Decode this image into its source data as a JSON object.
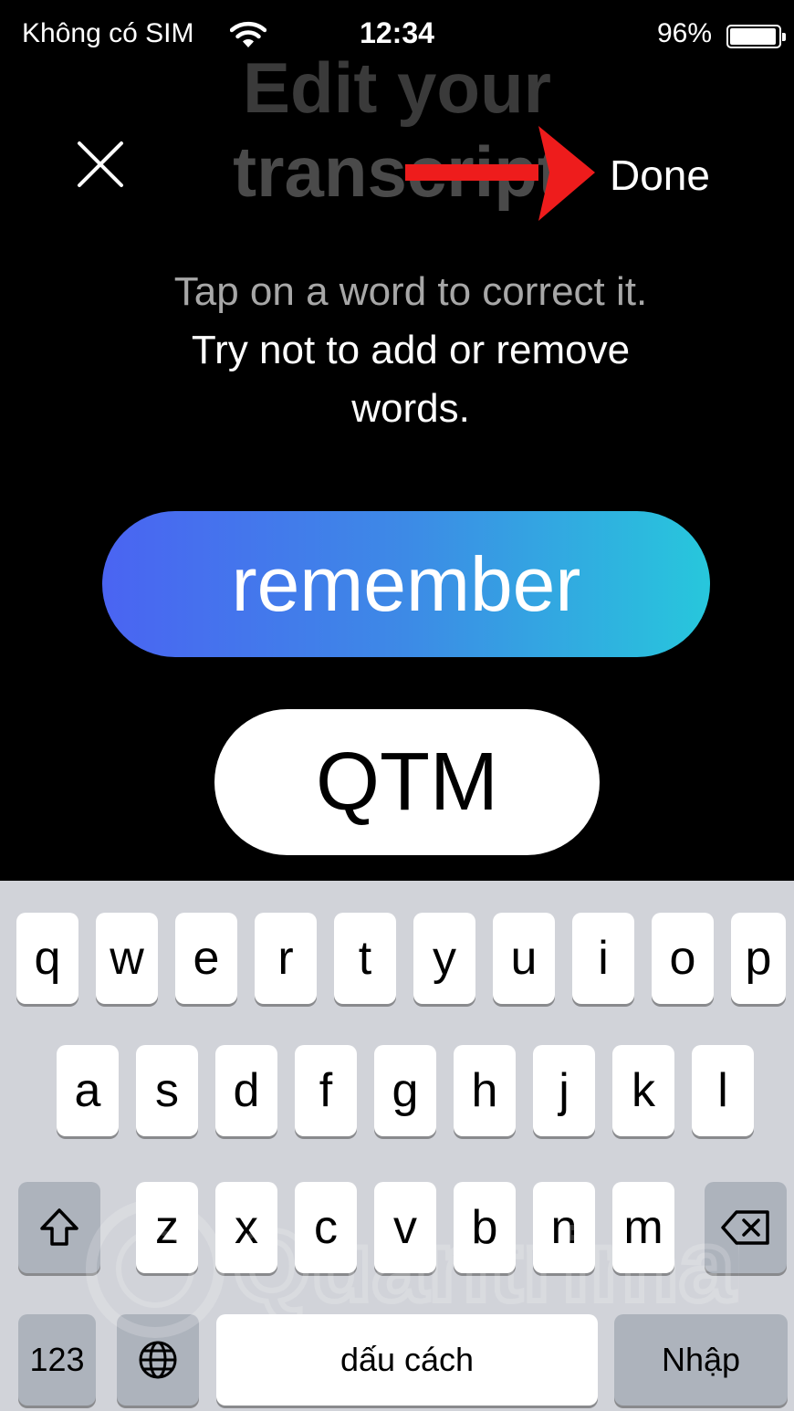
{
  "status_bar": {
    "carrier": "Không có SIM",
    "time": "12:34",
    "battery_pct": "96%",
    "wifi_icon": "wifi-icon",
    "battery_icon": "battery-icon"
  },
  "header": {
    "bg_title_line1": "Edit your",
    "bg_title_line2": "transcript",
    "close_icon": "close-icon",
    "done_label": "Done",
    "annotation": "red-arrow-pointing-to-done"
  },
  "instructions": {
    "line1": "Tap on a word to correct it.",
    "line2": "Try not to add or remove",
    "line3": "words."
  },
  "words": {
    "selected": "remember",
    "next": "QTM"
  },
  "keyboard": {
    "row1": [
      "q",
      "w",
      "e",
      "r",
      "t",
      "y",
      "u",
      "i",
      "o",
      "p"
    ],
    "row2": [
      "a",
      "s",
      "d",
      "f",
      "g",
      "h",
      "j",
      "k",
      "l"
    ],
    "row3": [
      "z",
      "x",
      "c",
      "v",
      "b",
      "n",
      "m"
    ],
    "shift_icon": "shift-icon",
    "backspace_icon": "backspace-icon",
    "numbers_label": "123",
    "globe_icon": "globe-icon",
    "space_label": "dấu cách",
    "return_label": "Nhập"
  },
  "watermark": "Quantrimang",
  "colors": {
    "pill_gradient_start": "#4a64f2",
    "pill_gradient_end": "#27c7dc",
    "arrow": "#ee1c1c",
    "keyboard_bg": "#d1d3d9"
  }
}
